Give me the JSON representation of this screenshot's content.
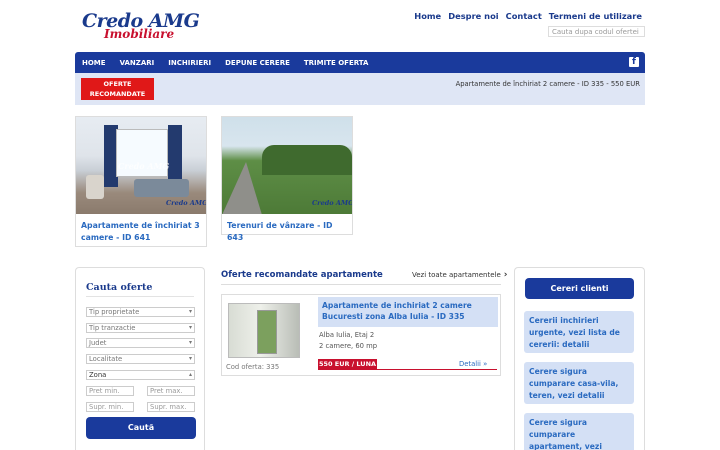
{
  "logo": {
    "line1": "Credo AMG",
    "line2": "Imobiliare"
  },
  "header": {
    "links": [
      "Home",
      "Despre noi",
      "Contact",
      "Termeni de utilizare"
    ],
    "search_placeholder": "Cauta dupa codul ofertei"
  },
  "nav": {
    "items": [
      "HOME",
      "VANZARI",
      "INCHIRIERI",
      "DEPUNE CERERE",
      "TRIMITE OFERTA"
    ],
    "facebook_icon": "f"
  },
  "subbar": {
    "recommended_label": "OFERTE RECOMANDATE",
    "ticker": "Apartamente de închiriat 2 camere - ID 335 - 550 EUR"
  },
  "cards": [
    {
      "title": "Apartamente de închiriat 3 camere - ID 641",
      "watermark": "Credo AMG"
    },
    {
      "title": "Terenuri de vânzare - ID 643",
      "watermark": "Credo AMG"
    }
  ],
  "search": {
    "title": "Cauta oferte",
    "selects": [
      "Tip proprietate",
      "Tip tranzactie",
      "Judet",
      "Localitate",
      "Zona"
    ],
    "price_min": "Pret min.",
    "price_max": "Pret max.",
    "area_min": "Supr. min.",
    "area_max": "Supr. max.",
    "button": "Cautã"
  },
  "offers": {
    "section_title": "Oferte recomandate apartamente",
    "view_all": "Vezi toate apartamentele",
    "items": [
      {
        "title": "Apartamente de inchiriat 2 camere Bucuresti zona Alba Iulia - ID 335",
        "location": "Alba Iulia, Etaj 2",
        "details": "2 camere, 60 mp",
        "code": "Cod oferta: 335",
        "price": "550 EUR / LUNA",
        "details_link": "Detalii"
      }
    ]
  },
  "clients": {
    "button": "Cereri clienti",
    "requests": [
      "Cererii inchirieri urgente, vezi lista de cererii: detalii",
      "Cerere sigura cumparare casa-vila, teren, vezi detalii",
      "Cerere sigura cumparare apartament, vezi"
    ]
  },
  "colors": {
    "brand_blue": "#1a3a9c",
    "accent_red": "#c8102e",
    "light_blue": "#d4e0f5"
  }
}
